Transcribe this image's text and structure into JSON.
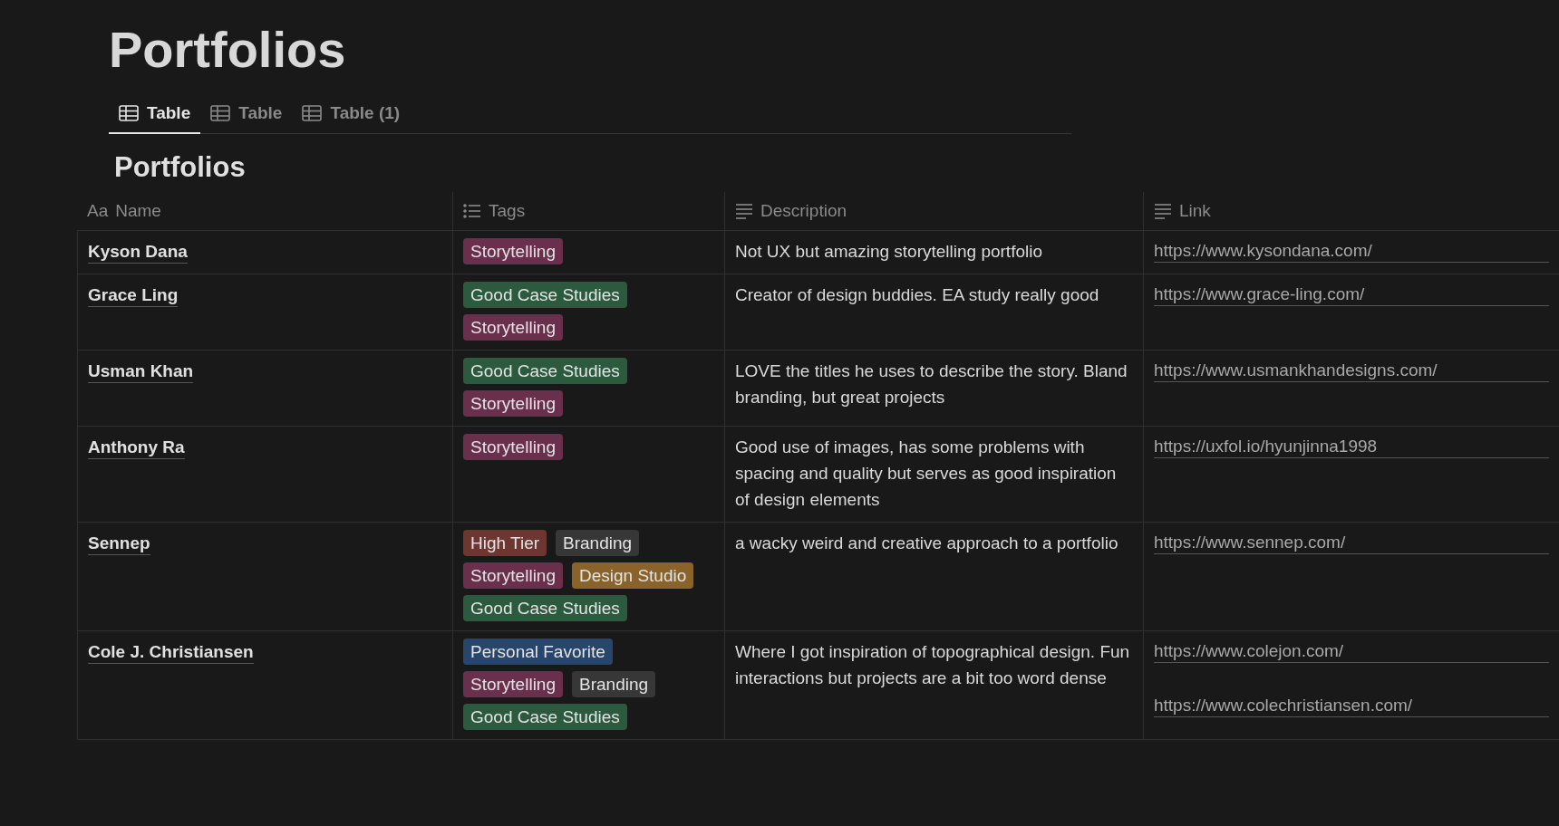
{
  "page": {
    "title": "Portfolios"
  },
  "tabs": [
    {
      "label": "Table",
      "selected": true
    },
    {
      "label": "Table",
      "selected": false
    },
    {
      "label": "Table (1)",
      "selected": false
    }
  ],
  "table": {
    "title": "Portfolios",
    "columns": [
      {
        "kind": "title",
        "icon_text": "Aa",
        "label": "Name"
      },
      {
        "kind": "multi_select",
        "label": "Tags"
      },
      {
        "kind": "text",
        "label": "Description"
      },
      {
        "kind": "text",
        "label": "Link"
      }
    ],
    "rows": [
      {
        "name": "Kyson Dana",
        "tags": [
          {
            "label": "Storytelling",
            "color": "#6b2f4e"
          }
        ],
        "description": "Not UX but amazing storytelling portfolio",
        "links": [
          "https://www.kysondana.com/"
        ]
      },
      {
        "name": "Grace Ling",
        "tags": [
          {
            "label": "Good Case Studies",
            "color": "#2b5a3f"
          },
          {
            "label": "Storytelling",
            "color": "#6b2f4e"
          }
        ],
        "description": "Creator of design buddies. EA study really good",
        "links": [
          "https://www.grace-ling.com/"
        ]
      },
      {
        "name": "Usman Khan",
        "tags": [
          {
            "label": "Good Case Studies",
            "color": "#2b5a3f"
          },
          {
            "label": "Storytelling",
            "color": "#6b2f4e"
          }
        ],
        "description": "LOVE the titles he uses to describe the story. Bland branding, but great projects",
        "links": [
          "https://www.usmankhandesigns.com/"
        ]
      },
      {
        "name": "Anthony Ra",
        "tags": [
          {
            "label": "Storytelling",
            "color": "#6b2f4e"
          }
        ],
        "description": "Good use of images, has some problems with spacing and quality but serves as good inspiration of design elements",
        "links": [
          "https://uxfol.io/hyunjinna1998"
        ]
      },
      {
        "name": "Sennep",
        "tags": [
          {
            "label": "High Tier",
            "color": "#6e3630"
          },
          {
            "label": "Branding",
            "color": "#373737"
          },
          {
            "label": "Storytelling",
            "color": "#6b2f4e"
          },
          {
            "label": "Design Studio",
            "color": "#89632a"
          },
          {
            "label": "Good Case Studies",
            "color": "#2b5a3f"
          }
        ],
        "description": "a wacky weird and creative approach to a portfolio",
        "links": [
          "https://www.sennep.com/"
        ]
      },
      {
        "name": "Cole J. Christiansen",
        "tags": [
          {
            "label": "Personal Favorite",
            "color": "#28456c"
          },
          {
            "label": "Storytelling",
            "color": "#6b2f4e"
          },
          {
            "label": "Branding",
            "color": "#373737"
          },
          {
            "label": "Good Case Studies",
            "color": "#2b5a3f"
          }
        ],
        "description": "Where I got inspiration of topographical design. Fun interactions but projects are a bit too word dense",
        "links": [
          "https://www.colejon.com/",
          "https://www.colechristiansen.com/"
        ]
      }
    ]
  }
}
